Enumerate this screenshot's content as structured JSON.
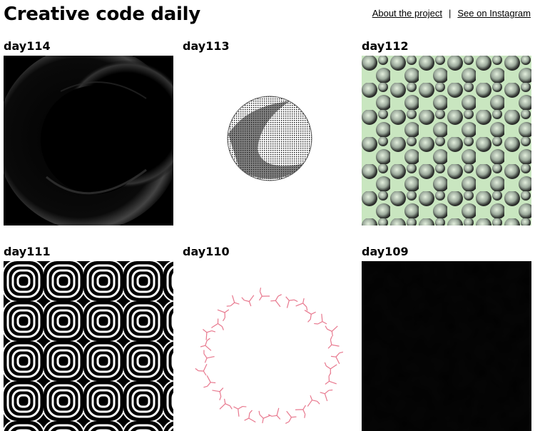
{
  "site": {
    "title": "Creative code daily"
  },
  "nav": {
    "about": "About the project",
    "separator": "|",
    "instagram": "See on Instagram"
  },
  "colors": {
    "text": "#000000",
    "link": "#000000",
    "background": "#ffffff",
    "accent_green": "#c9e6c0",
    "accent_pink": "#e8788e"
  },
  "posts": [
    {
      "title": "day114"
    },
    {
      "title": "day113"
    },
    {
      "title": "day112"
    },
    {
      "title": "day111"
    },
    {
      "title": "day110"
    },
    {
      "title": "day109"
    }
  ]
}
